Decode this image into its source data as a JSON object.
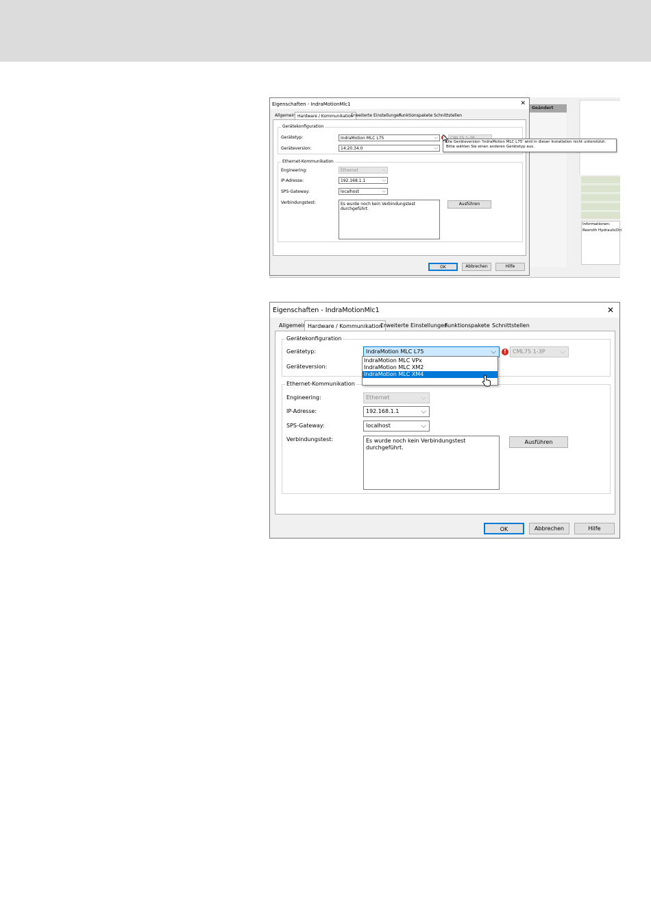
{
  "screen1": {
    "background": {
      "header_label": "Geändert",
      "info_label": "Informationen:",
      "info_value": "Rexroth HydraulicDri"
    },
    "dialog": {
      "title": "Eigenschaften - IndraMotionMlc1",
      "close": "✕",
      "tabs": [
        "Allgemein",
        "Hardware / Kommunikation",
        "Erweiterte Einstellungen",
        "Funktionspakete",
        "Schnittstellen"
      ],
      "device_group": {
        "legend": "Gerätekonfiguration",
        "type_label": "Gerätetyp:",
        "type_value": "IndraMotion MLC L75",
        "sub_value": "CML75 1-3P",
        "version_label": "Geräteversion:",
        "version_value": "14.20.34.0"
      },
      "ethernet_group": {
        "legend": "Ethernet-Kommunikation",
        "engineering_label": "Engineering:",
        "engineering_value": "Ethernet",
        "ip_label": "IP-Adresse:",
        "ip_value": "192.168.1.1",
        "gateway_label": "SPS-Gateway:",
        "gateway_value": "localhost",
        "test_label": "Verbindungstest:",
        "test_text_1": "Es wurde noch kein Verbindungstest",
        "test_text_2": "durchgeführt.",
        "run_button": "Ausführen"
      },
      "buttons": {
        "ok": "OK",
        "cancel": "Abbrechen",
        "help": "Hilfe"
      }
    },
    "tooltip": {
      "line1": "Die Geräteversion 'IndraMotion MLC L75' wird in dieser Installation nicht unterstützt.",
      "line2": "Bitte wählen Sie einen anderen Gerätetyp aus."
    }
  },
  "screen2": {
    "dialog": {
      "title": "Eigenschaften - IndraMotionMlc1",
      "close": "✕",
      "tabs": [
        "Allgemein",
        "Hardware / Kommunikation",
        "Erweiterte Einstellungen",
        "Funktionspakete",
        "Schnittstellen"
      ],
      "device_group": {
        "legend": "Gerätekonfiguration",
        "type_label": "Gerätetyp:",
        "type_value": "IndraMotion MLC L75",
        "sub_value": "CML75 1-3P",
        "version_label": "Geräteversion:"
      },
      "dropdown_options": [
        "IndraMotion MLC VPx",
        "IndraMotion MLC XM2",
        "IndraMotion MLC XM4"
      ],
      "ethernet_group": {
        "legend": "Ethernet-Kommunikation",
        "engineering_label": "Engineering:",
        "engineering_value": "Ethernet",
        "ip_label": "IP-Adresse:",
        "ip_value": "192.168.1.1",
        "gateway_label": "SPS-Gateway:",
        "gateway_value": "localhost",
        "test_label": "Verbindungstest:",
        "test_text_1": "Es wurde noch kein Verbindungstest",
        "test_text_2": "durchgeführt.",
        "run_button": "Ausführen"
      },
      "buttons": {
        "ok": "OK",
        "cancel": "Abbrechen",
        "help": "Hilfe"
      }
    }
  },
  "icons": {
    "warning": "!",
    "chevron": "⌵"
  },
  "colors": {
    "accent": "#0078d7",
    "selection": "#cce8ff",
    "warning": "#d9261c"
  }
}
